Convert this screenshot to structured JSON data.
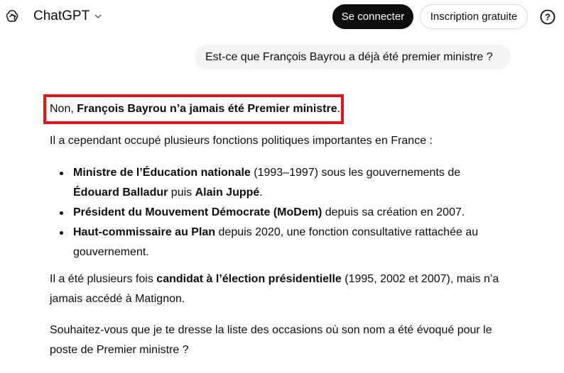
{
  "header": {
    "app_name": "ChatGPT",
    "login_label": "Se connecter",
    "signup_label": "Inscription gratuite",
    "help_label": "?"
  },
  "user_message": "Est-ce que François Bayrou a déjà été premier ministre ?",
  "answer": {
    "p1": {
      "a": "Non, ",
      "b": "François Bayrou n’a jamais été Premier ministre",
      "c": "."
    },
    "p2": "Il a cependant occupé plusieurs fonctions politiques importantes en France :",
    "bullets": [
      {
        "b1": "Ministre de l’Éducation nationale",
        "t1": " (1993–1997) sous les gouvernements de",
        "b2": "Édouard Balladur",
        "t2": " puis ",
        "b3": "Alain Juppé",
        "t3": "."
      },
      {
        "b1": "Président du Mouvement Démocrate (MoDem)",
        "t1": " depuis sa création en 2007."
      },
      {
        "b1": "Haut-commissaire au Plan",
        "t1": " depuis 2020, une fonction consultative rattachée au",
        "t2": "gouvernement."
      }
    ],
    "p3": {
      "a": "Il a été plusieurs fois ",
      "b": "candidat à l’élection présidentielle",
      "c": " (1995, 2002 et 2007), mais n’a",
      "d": "jamais accédé à Matignon."
    },
    "p4": {
      "a": "Souhaitez-vous que je te dresse la liste des occasions où son nom a été évoqué pour le",
      "b": "poste de Premier ministre ?"
    }
  },
  "colors": {
    "highlight": "#e3121b",
    "accent": "#0d0d0d",
    "bubble": "#f4f4f4"
  }
}
